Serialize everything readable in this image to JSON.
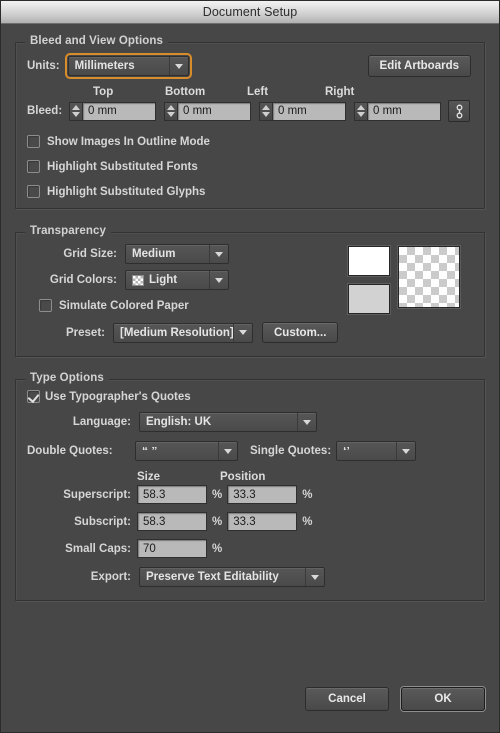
{
  "window": {
    "title": "Document Setup"
  },
  "colors": {
    "dialog_bg": "#474747",
    "focus_ring": "#d88c2a",
    "field_bg": "#b9b9b9",
    "swatch_white": "#ffffff",
    "swatch_gray": "#d2d2d2"
  },
  "bleed_section": {
    "title": "Bleed and View Options",
    "units_label": "Units:",
    "units_value": "Millimeters",
    "edit_artboards_label": "Edit Artboards",
    "bleed_label": "Bleed:",
    "column_headers": [
      "Top",
      "Bottom",
      "Left",
      "Right"
    ],
    "bleed_values": [
      "0 mm",
      "0 mm",
      "0 mm",
      "0 mm"
    ],
    "link_icon": "chain-link-icon",
    "checkboxes": [
      {
        "label": "Show Images In Outline Mode",
        "checked": false
      },
      {
        "label": "Highlight Substituted Fonts",
        "checked": false
      },
      {
        "label": "Highlight Substituted Glyphs",
        "checked": false
      }
    ]
  },
  "transparency_section": {
    "title": "Transparency",
    "grid_size_label": "Grid Size:",
    "grid_size_value": "Medium",
    "grid_colors_label": "Grid Colors:",
    "grid_colors_value": "Light",
    "grid_colors_icon": "checkerboard-icon",
    "simulate_label": "Simulate Colored Paper",
    "simulate_checked": false,
    "preset_label": "Preset:",
    "preset_value": "[Medium Resolution]",
    "custom_label": "Custom...",
    "preview_icon": "transparency-checkerboard-preview"
  },
  "type_section": {
    "title": "Type Options",
    "typographers_quotes_label": "Use Typographer's Quotes",
    "typographers_quotes_checked": true,
    "language_label": "Language:",
    "language_value": "English: UK",
    "double_quotes_label": "Double Quotes:",
    "double_quotes_value": "“ ”",
    "single_quotes_label": "Single Quotes:",
    "single_quotes_value": "‘’",
    "size_header": "Size",
    "position_header": "Position",
    "superscript_label": "Superscript:",
    "superscript_size": "58.3",
    "superscript_position": "33.3",
    "subscript_label": "Subscript:",
    "subscript_size": "58.3",
    "subscript_position": "33.3",
    "small_caps_label": "Small Caps:",
    "small_caps_value": "70",
    "percent": "%",
    "export_label": "Export:",
    "export_value": "Preserve Text Editability"
  },
  "footer": {
    "cancel_label": "Cancel",
    "ok_label": "OK"
  }
}
